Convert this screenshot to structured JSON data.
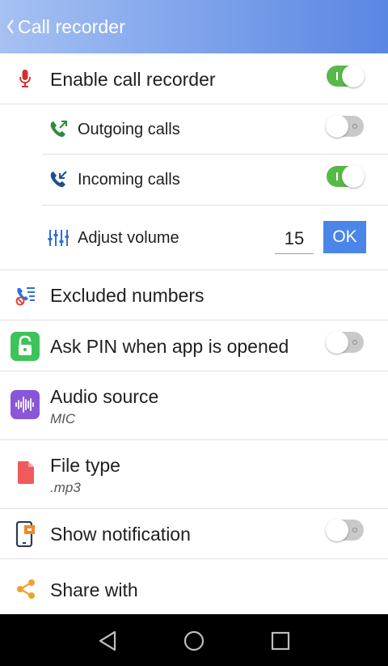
{
  "header": {
    "title": "Call recorder",
    "background": "#7fa4ec"
  },
  "settings": {
    "enable_recorder": {
      "label": "Enable call recorder",
      "enabled": true
    },
    "outgoing_calls": {
      "label": "Outgoing calls",
      "enabled": false
    },
    "incoming_calls": {
      "label": "Incoming calls",
      "enabled": true
    },
    "adjust_volume": {
      "label": "Adjust volume",
      "value": "15",
      "button": "OK"
    },
    "excluded_numbers": {
      "label": "Excluded numbers"
    },
    "ask_pin": {
      "label": "Ask PIN when app is opened",
      "enabled": false
    },
    "audio_source": {
      "label": "Audio source",
      "value": "MIC"
    },
    "file_type": {
      "label": "File type",
      "value": ".mp3"
    },
    "show_notification": {
      "label": "Show notification",
      "enabled": false
    },
    "share_with": {
      "label": "Share with"
    }
  },
  "colors": {
    "toggle_on": "#59b84a",
    "toggle_off": "#c9c9c9",
    "accent_button": "#4a86e8",
    "mic_icon": "#d32f2f",
    "phone_out_icon": "#2e8b3d",
    "phone_in_icon": "#1f4f8f",
    "lock_icon": "#3cc45a",
    "audio_icon": "#8a56d8",
    "file_icon": "#f05a5a",
    "share_icon": "#f0a030"
  },
  "icons": {
    "back": "chevron-left-icon",
    "mic": "microphone-icon",
    "outgoing": "outgoing-call-icon",
    "incoming": "incoming-call-icon",
    "volume": "volume-sliders-icon",
    "excluded": "excluded-numbers-icon",
    "pin": "lock-icon",
    "audio": "audio-waveform-icon",
    "file": "file-icon",
    "notification": "notification-phone-icon",
    "share": "share-icon"
  },
  "navbar": {
    "back": "nav-back-icon",
    "home": "nav-home-icon",
    "recents": "nav-recents-icon"
  }
}
